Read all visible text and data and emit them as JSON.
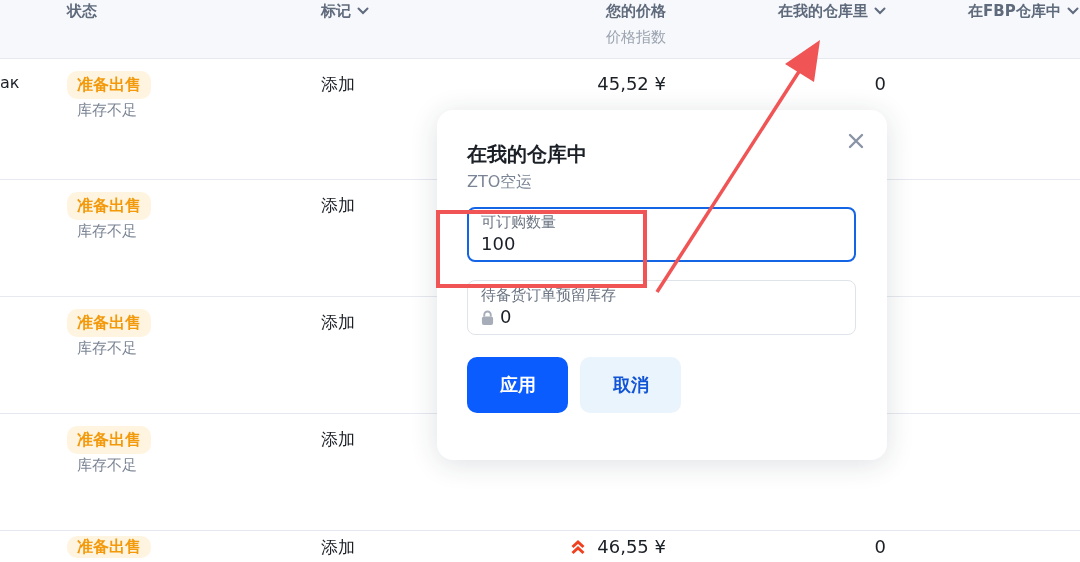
{
  "table": {
    "columns": [
      {
        "label": "状态",
        "dropdown": false
      },
      {
        "label": "标记",
        "dropdown": true
      },
      {
        "label": "您的价格",
        "sublabel": "价格指数",
        "dropdown": false
      },
      {
        "label": "在我的仓库里",
        "dropdown": true
      },
      {
        "label": "在FBP仓库中",
        "dropdown": true
      }
    ],
    "rows": [
      {
        "product": "ак",
        "status": "准备出售",
        "stock_note": "库存不足",
        "mark": "添加",
        "price": "45,52 ¥",
        "price_flag": false,
        "warehouse": "0"
      },
      {
        "status": "准备出售",
        "stock_note": "库存不足",
        "mark": "添加"
      },
      {
        "status": "准备出售",
        "stock_note": "库存不足",
        "mark": "添加"
      },
      {
        "status": "准备出售",
        "stock_note": "库存不足",
        "mark": "添加"
      },
      {
        "status": "准备出售",
        "mark": "添加",
        "price": "46,55 ¥",
        "price_flag": true,
        "warehouse": "0"
      }
    ]
  },
  "modal": {
    "title": "在我的仓库中",
    "subtitle": "ZTO空运",
    "fields": [
      {
        "label": "可订购数量",
        "value": "100",
        "focused": true,
        "locked": false
      },
      {
        "label": "待备货订单预留库存",
        "value": "0",
        "focused": false,
        "locked": true
      }
    ],
    "buttons": [
      {
        "label": "应用",
        "kind": "primary"
      },
      {
        "label": "取消",
        "kind": "secondary"
      }
    ]
  }
}
